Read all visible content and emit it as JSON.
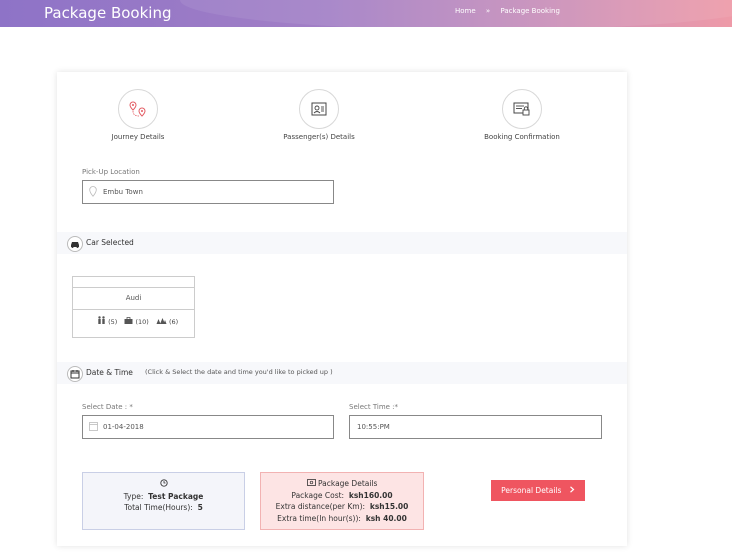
{
  "header": {
    "title": "Package Booking",
    "breadcrumb": {
      "home": "Home",
      "separator": "»",
      "current": "Package Booking"
    }
  },
  "steps": [
    {
      "label": "Journey Details",
      "icon": "map-pin-route-icon"
    },
    {
      "label": "Passenger(s) Details",
      "icon": "id-card-icon"
    },
    {
      "label": "Booking Confirmation",
      "icon": "ticket-lock-icon"
    }
  ],
  "pickup": {
    "label": "Pick-Up Location",
    "value": "Embu Town",
    "icon": "location-pin-icon"
  },
  "car_section": {
    "title": "Car Selected",
    "icon": "car-icon"
  },
  "car": {
    "name": "Audi",
    "passengers": "(5)",
    "luggage": "(10)",
    "extra": "(6)"
  },
  "datetime_section": {
    "title": "Date & Time",
    "hint": "(Click & Select the date and time you'd like to picked up )",
    "icon": "calendar-icon"
  },
  "date": {
    "label": "Select Date : *",
    "value": "01-04-2018",
    "icon": "calendar-small-icon"
  },
  "time": {
    "label": "Select Time :*",
    "hours": "10",
    "minutes": "55",
    "period": "PM"
  },
  "package_type": {
    "icon": "clock-icon",
    "type_label": "Type:",
    "type_value": "Test Package",
    "hours_label": "Total Time(Hours):",
    "hours_value": "5"
  },
  "package_details": {
    "title": "Package Details",
    "icon": "money-icon",
    "cost_label": "Package Cost:",
    "cost_value": "ksh160.00",
    "extra_distance_label": "Extra distance(per Km):",
    "extra_distance_value": "ksh15.00",
    "extra_time_label": "Extra time(In hour(s)):",
    "extra_time_value": "ksh 40.00"
  },
  "next_button": {
    "label": "Personal Details",
    "icon": "chevron-right-icon",
    "color": "#ef5560"
  },
  "colors": {
    "header_start": "#8e73c7",
    "header_end": "#ee9aa8",
    "accent": "#ef5560"
  }
}
